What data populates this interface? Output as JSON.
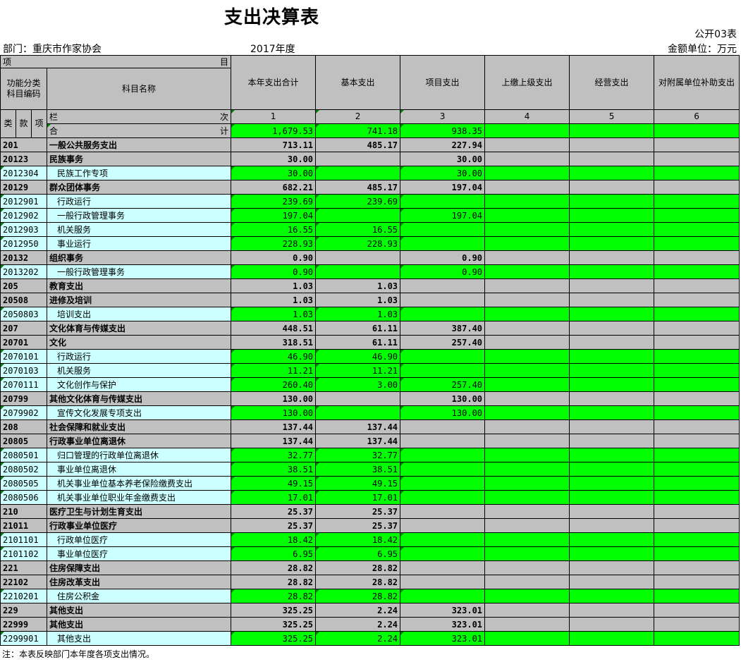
{
  "header": {
    "title": "支出决算表",
    "table_no": "公开03表",
    "department": "部门：重庆市作家协会",
    "year": "2017年度",
    "unit": "金额单位：万元"
  },
  "columns": {
    "item": "项",
    "mu": "目",
    "func_code": "功能分类科目编码",
    "subject_name": "科目名称",
    "total": "本年支出合计",
    "basic": "基本支出",
    "project": "项目支出",
    "superior": "上缴上级支出",
    "business": "经营支出",
    "subsidy": "对附属单位补助支出",
    "lei": "类",
    "kuan": "款",
    "xiang": "项",
    "lan": "栏",
    "ci": "次",
    "n1": "1",
    "n2": "2",
    "n3": "3",
    "n4": "4",
    "n5": "5",
    "n6": "6",
    "he": "合",
    "ji": "计"
  },
  "totals": {
    "total": "1,679.53",
    "basic": "741.18",
    "project": "938.35"
  },
  "rows": [
    {
      "code": "201",
      "name": "一般公共服务支出",
      "total": "713.11",
      "basic": "485.17",
      "project": "227.94",
      "level": "lvl"
    },
    {
      "code": "20123",
      "name": "民族事务",
      "total": "30.00",
      "basic": "",
      "project": "30.00",
      "level": "lvl"
    },
    {
      "code": "2012304",
      "name": "民族工作专项",
      "total": "30.00",
      "basic": "",
      "project": "30.00",
      "level": "leaf"
    },
    {
      "code": "20129",
      "name": "群众团体事务",
      "total": "682.21",
      "basic": "485.17",
      "project": "197.04",
      "level": "lvl"
    },
    {
      "code": "2012901",
      "name": "行政运行",
      "total": "239.69",
      "basic": "239.69",
      "project": "",
      "level": "leaf"
    },
    {
      "code": "2012902",
      "name": "一般行政管理事务",
      "total": "197.04",
      "basic": "",
      "project": "197.04",
      "level": "leaf"
    },
    {
      "code": "2012903",
      "name": "机关服务",
      "total": "16.55",
      "basic": "16.55",
      "project": "",
      "level": "leaf"
    },
    {
      "code": "2012950",
      "name": "事业运行",
      "total": "228.93",
      "basic": "228.93",
      "project": "",
      "level": "leaf"
    },
    {
      "code": "20132",
      "name": "组织事务",
      "total": "0.90",
      "basic": "",
      "project": "0.90",
      "level": "lvl"
    },
    {
      "code": "2013202",
      "name": "一般行政管理事务",
      "total": "0.90",
      "basic": "",
      "project": "0.90",
      "level": "leaf"
    },
    {
      "code": "205",
      "name": "教育支出",
      "total": "1.03",
      "basic": "1.03",
      "project": "",
      "level": "lvl"
    },
    {
      "code": "20508",
      "name": "进修及培训",
      "total": "1.03",
      "basic": "1.03",
      "project": "",
      "level": "lvl"
    },
    {
      "code": "2050803",
      "name": "培训支出",
      "total": "1.03",
      "basic": "1.03",
      "project": "",
      "level": "leaf"
    },
    {
      "code": "207",
      "name": "文化体育与传媒支出",
      "total": "448.51",
      "basic": "61.11",
      "project": "387.40",
      "level": "lvl"
    },
    {
      "code": "20701",
      "name": "文化",
      "total": "318.51",
      "basic": "61.11",
      "project": "257.40",
      "level": "lvl"
    },
    {
      "code": "2070101",
      "name": "行政运行",
      "total": "46.90",
      "basic": "46.90",
      "project": "",
      "level": "leaf"
    },
    {
      "code": "2070103",
      "name": "机关服务",
      "total": "11.21",
      "basic": "11.21",
      "project": "",
      "level": "leaf"
    },
    {
      "code": "2070111",
      "name": "文化创作与保护",
      "total": "260.40",
      "basic": "3.00",
      "project": "257.40",
      "level": "leaf"
    },
    {
      "code": "20799",
      "name": "其他文化体育与传媒支出",
      "total": "130.00",
      "basic": "",
      "project": "130.00",
      "level": "lvl"
    },
    {
      "code": "2079902",
      "name": "宣传文化发展专项支出",
      "total": "130.00",
      "basic": "",
      "project": "130.00",
      "level": "leaf"
    },
    {
      "code": "208",
      "name": "社会保障和就业支出",
      "total": "137.44",
      "basic": "137.44",
      "project": "",
      "level": "lvl"
    },
    {
      "code": "20805",
      "name": "行政事业单位离退休",
      "total": "137.44",
      "basic": "137.44",
      "project": "",
      "level": "lvl"
    },
    {
      "code": "2080501",
      "name": "归口管理的行政单位离退休",
      "total": "32.77",
      "basic": "32.77",
      "project": "",
      "level": "leaf"
    },
    {
      "code": "2080502",
      "name": "事业单位离退休",
      "total": "38.51",
      "basic": "38.51",
      "project": "",
      "level": "leaf"
    },
    {
      "code": "2080505",
      "name": "机关事业单位基本养老保险缴费支出",
      "total": "49.15",
      "basic": "49.15",
      "project": "",
      "level": "leaf"
    },
    {
      "code": "2080506",
      "name": "机关事业单位职业年金缴费支出",
      "total": "17.01",
      "basic": "17.01",
      "project": "",
      "level": "leaf"
    },
    {
      "code": "210",
      "name": "医疗卫生与计划生育支出",
      "total": "25.37",
      "basic": "25.37",
      "project": "",
      "level": "lvl"
    },
    {
      "code": "21011",
      "name": "行政事业单位医疗",
      "total": "25.37",
      "basic": "25.37",
      "project": "",
      "level": "lvl"
    },
    {
      "code": "2101101",
      "name": "行政单位医疗",
      "total": "18.42",
      "basic": "18.42",
      "project": "",
      "level": "leaf"
    },
    {
      "code": "2101102",
      "name": "事业单位医疗",
      "total": "6.95",
      "basic": "6.95",
      "project": "",
      "level": "leaf"
    },
    {
      "code": "221",
      "name": "住房保障支出",
      "total": "28.82",
      "basic": "28.82",
      "project": "",
      "level": "lvl"
    },
    {
      "code": "22102",
      "name": "住房改革支出",
      "total": "28.82",
      "basic": "28.82",
      "project": "",
      "level": "lvl"
    },
    {
      "code": "2210201",
      "name": "住房公积金",
      "total": "28.82",
      "basic": "28.82",
      "project": "",
      "level": "leaf"
    },
    {
      "code": "229",
      "name": "其他支出",
      "total": "325.25",
      "basic": "2.24",
      "project": "323.01",
      "level": "lvl"
    },
    {
      "code": "22999",
      "name": "其他支出",
      "total": "325.25",
      "basic": "2.24",
      "project": "323.01",
      "level": "lvl"
    },
    {
      "code": "2299901",
      "name": "其他支出",
      "total": "325.25",
      "basic": "2.24",
      "project": "323.01",
      "level": "leaf"
    }
  ],
  "footer": {
    "note": "注：本表反映部门本年度各项支出情况。"
  }
}
